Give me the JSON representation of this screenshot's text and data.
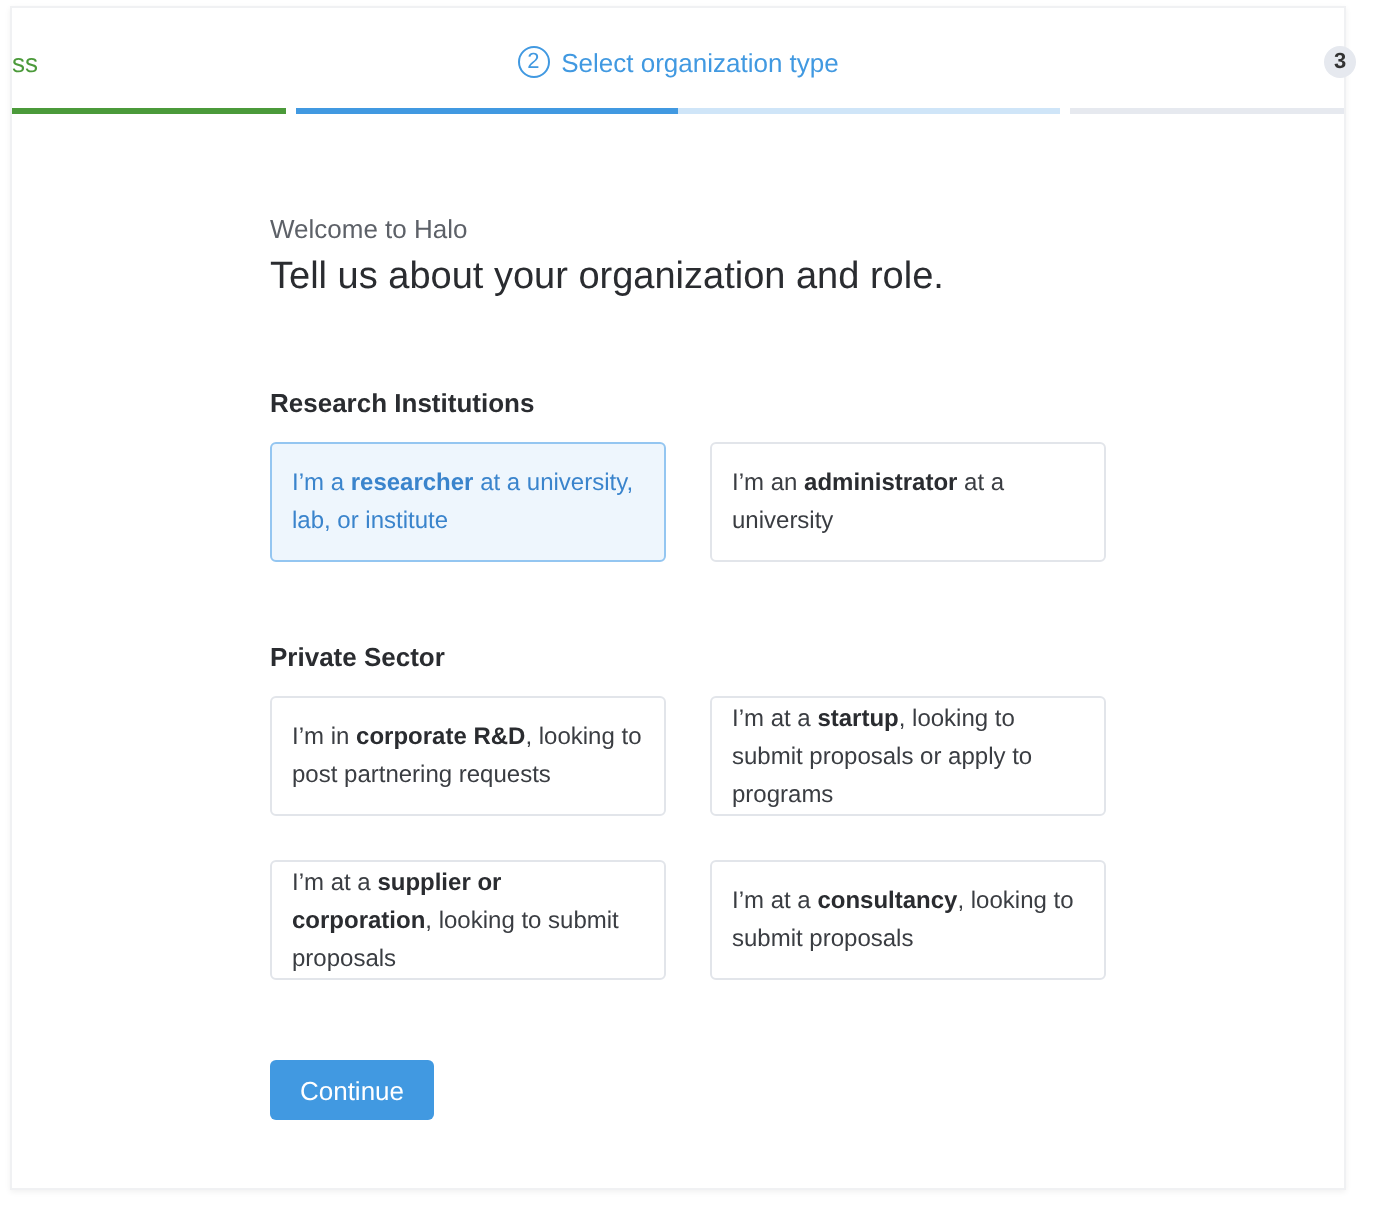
{
  "stepper": [
    {
      "kind": "done",
      "label": "ss",
      "level": 1
    },
    {
      "kind": "current",
      "number": "2",
      "label": "Select organization type",
      "level": 0.5
    },
    {
      "kind": "upcoming",
      "number": "3",
      "level": 0
    }
  ],
  "intro": "Welcome to Halo",
  "title": "Tell us about your organization and role.",
  "sections": [
    {
      "heading": "Research Institutions",
      "options": [
        {
          "text": "I’m a **researcher** at a university, lab, or institute",
          "selected": true
        },
        {
          "text": "I’m an **administrator** at a university",
          "selected": false
        }
      ]
    },
    {
      "heading": "Private Sector",
      "options": [
        {
          "text": "I’m in **corporate R&D**, looking to post partnering requests",
          "selected": false
        },
        {
          "text": "I’m at a **startup**, looking to submit proposals or apply to programs",
          "selected": false
        },
        {
          "text": "I’m at a **supplier or corporation**, looking to submit proposals",
          "selected": false
        },
        {
          "text": "I’m at a **consultancy**, looking to submit proposals",
          "selected": false
        }
      ]
    }
  ],
  "continue_button": "Continue"
}
